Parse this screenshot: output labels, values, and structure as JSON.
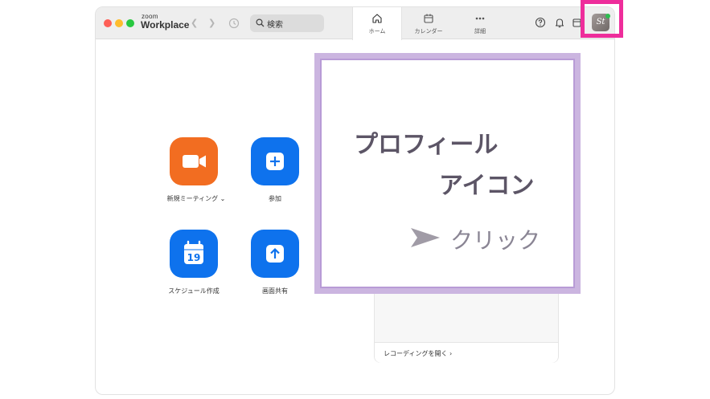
{
  "app": {
    "brand_small": "zoom",
    "brand_name": "Workplace"
  },
  "search": {
    "label": "検索"
  },
  "tabs": [
    {
      "label": "ホーム",
      "icon": "home-icon"
    },
    {
      "label": "カレンダー",
      "icon": "calendar-icon"
    },
    {
      "label": "詳細",
      "icon": "more-icon"
    }
  ],
  "profile": {
    "initials": "St",
    "status_color": "#2dbd4f"
  },
  "actions": [
    {
      "label": "新規ミーティング ⌄",
      "icon": "video-camera-icon",
      "color": "#f26d21"
    },
    {
      "label": "参加",
      "icon": "plus-icon",
      "color": "#0e72ed"
    },
    {
      "label": "スケジュール作成",
      "icon": "calendar-19-icon",
      "color": "#0e72ed",
      "calendar_day": "19"
    },
    {
      "label": "画面共有",
      "icon": "share-screen-icon",
      "color": "#0e72ed"
    }
  ],
  "recordings": {
    "link": "レコーディングを開く ›"
  },
  "callout": {
    "line1": "プロフィール",
    "line2": "アイコン",
    "click": "クリック"
  },
  "colors": {
    "highlight": "#ee2d9b",
    "callout_border": "#cbb5e0",
    "zoom_blue": "#0e72ed",
    "zoom_orange": "#f26d21"
  }
}
